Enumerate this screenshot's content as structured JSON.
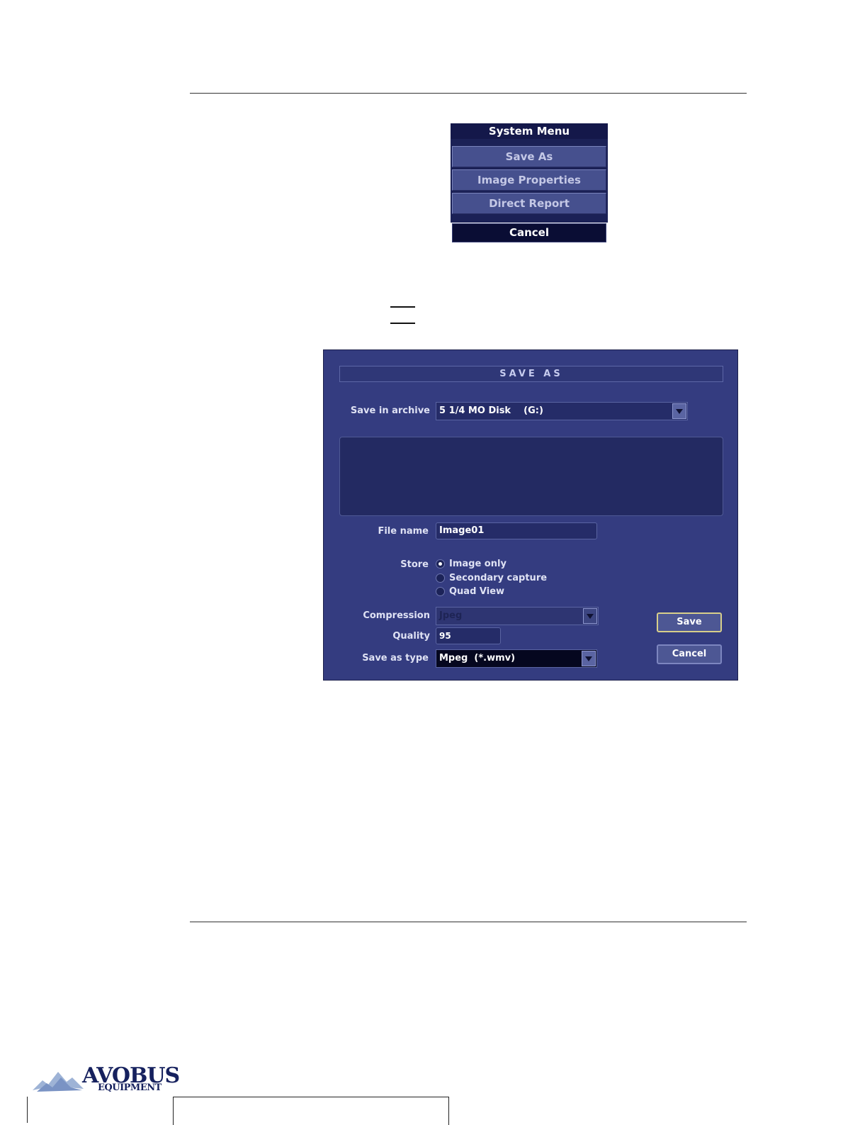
{
  "system_menu": {
    "title": "System Menu",
    "items": [
      "Save As",
      "Image Properties",
      "Direct Report"
    ],
    "cancel": "Cancel"
  },
  "save_as_dialog": {
    "title": "SAVE AS",
    "archive_label": "Save in archive",
    "archive_value": "5 1/4 MO Disk    (G:)",
    "file_name_label": "File name",
    "file_name_value": "Image01",
    "store_label": "Store",
    "store_options": [
      "Image only",
      "Secondary capture",
      "Quad View"
    ],
    "store_selected": "Image only",
    "compression_label": "Compression",
    "compression_value": "Jpeg",
    "quality_label": "Quality",
    "quality_value": "95",
    "save_type_label": "Save as type",
    "save_type_value": "Mpeg  (*.wmv)",
    "save_button": "Save",
    "cancel_button": "Cancel"
  },
  "logo": {
    "name": "AVOBUS",
    "subtitle": "EQUIPMENT"
  },
  "colors": {
    "dialog_bg": "#343c80",
    "menu_title_bg": "#14184a",
    "logo_text": "#16215e"
  }
}
